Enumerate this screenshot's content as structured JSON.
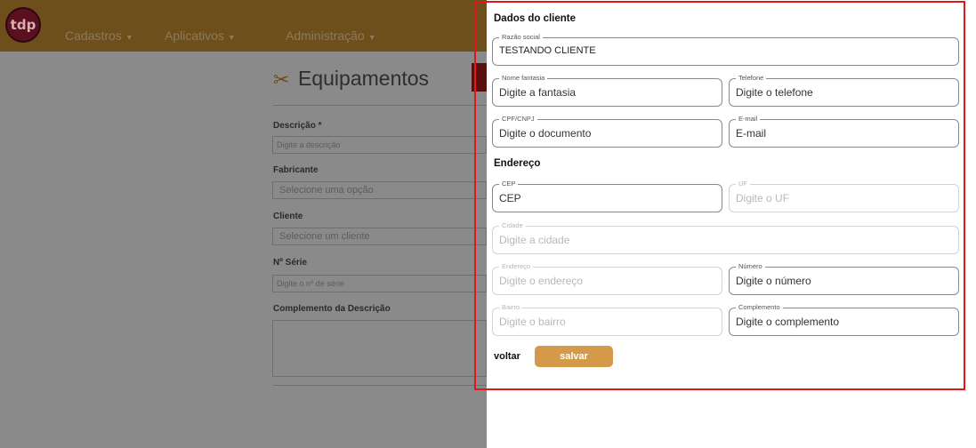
{
  "navbar": {
    "logo_text": "tdp",
    "items": [
      {
        "label": "Cadastros"
      },
      {
        "label": "Aplicativos"
      },
      {
        "label": "Administração"
      }
    ]
  },
  "background_page": {
    "title": "Equipamentos",
    "fields": [
      {
        "label": "Descrição *",
        "placeholder": "Digite a descrição"
      },
      {
        "label": "Fabricante",
        "placeholder": "Selecione uma opção"
      },
      {
        "label": "Cliente",
        "placeholder": "Selecione um cliente"
      },
      {
        "label": "Nº Série",
        "placeholder": "Digite o nº de série"
      },
      {
        "label": "Complemento da Descrição",
        "placeholder": ""
      }
    ]
  },
  "modal": {
    "section_client": "Dados do cliente",
    "section_address": "Endereço",
    "fields": {
      "razao_social": {
        "label": "Razão social",
        "value": "TESTANDO CLIENTE"
      },
      "nome_fantasia": {
        "label": "Nome fantasia",
        "placeholder": "Digite a fantasia"
      },
      "telefone": {
        "label": "Telefone",
        "placeholder": "Digite o telefone"
      },
      "documento": {
        "label": "CPF/CNPJ",
        "placeholder": "Digite o documento"
      },
      "email": {
        "label": "E-mail",
        "placeholder": "E-mail"
      },
      "cep": {
        "label": "CEP",
        "placeholder": "CEP"
      },
      "uf": {
        "label": "UF",
        "placeholder": "Digite o UF"
      },
      "cidade": {
        "label": "Cidade",
        "placeholder": "Digite a cidade"
      },
      "endereco": {
        "label": "Endereço",
        "placeholder": "Digite o endereço"
      },
      "numero": {
        "label": "Número",
        "placeholder": "Digite o número"
      },
      "bairro": {
        "label": "Bairro",
        "placeholder": "Digite o bairro"
      },
      "complemento": {
        "label": "Complemento",
        "placeholder": "Digite o complemento"
      }
    },
    "back_label": "voltar",
    "save_label": "salvar"
  },
  "colors": {
    "accent": "#d49a4a",
    "highlight": "#e01818"
  }
}
